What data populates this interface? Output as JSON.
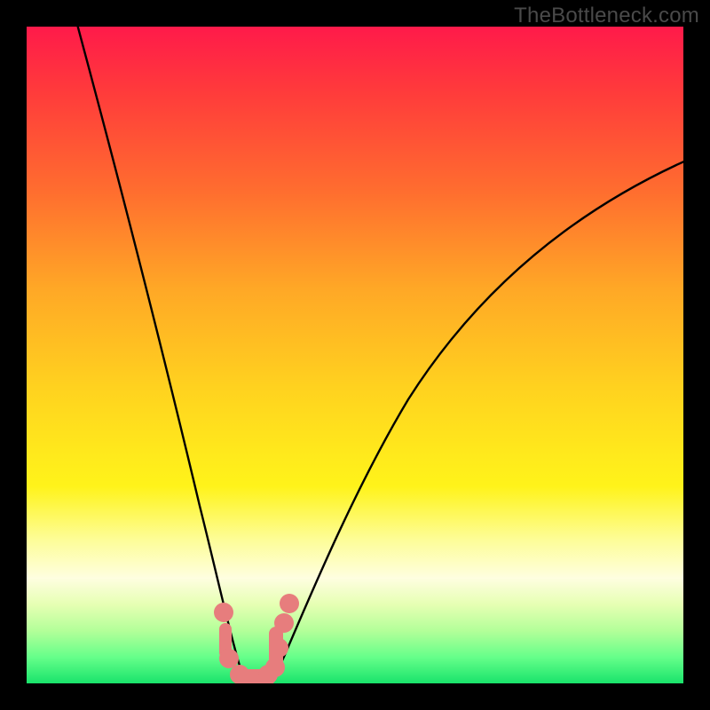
{
  "watermark": "TheBottleneck.com",
  "chart_data": {
    "type": "line",
    "title": "",
    "xlabel": "",
    "ylabel": "",
    "xlim": [
      0,
      100
    ],
    "ylim": [
      0,
      100
    ],
    "series": [
      {
        "name": "bottleneck-curve",
        "x": [
          5,
          8,
          12,
          16,
          20,
          24,
          26,
          28,
          30,
          31,
          32,
          33,
          34,
          35,
          37,
          39,
          41,
          45,
          50,
          56,
          62,
          70,
          80,
          92,
          100
        ],
        "y": [
          100,
          90,
          78,
          64,
          50,
          36,
          28,
          20,
          12,
          7,
          4,
          2,
          1,
          1,
          2,
          6,
          12,
          22,
          32,
          42,
          50,
          58,
          66,
          74,
          78
        ]
      }
    ],
    "highlight_points": {
      "name": "optimal-zone-markers",
      "x": [
        30.5,
        31,
        31.5,
        33,
        34.5,
        35.5,
        36,
        37,
        37.5,
        38
      ],
      "y": [
        10,
        6,
        3,
        1,
        1,
        1.5,
        2,
        5,
        8,
        12
      ]
    },
    "background_zones": [
      {
        "name": "severe-bottleneck",
        "color": "#ff1a4a",
        "y_range": [
          70,
          100
        ]
      },
      {
        "name": "high-bottleneck",
        "color": "#ff8a2a",
        "y_range": [
          40,
          70
        ]
      },
      {
        "name": "moderate-bottleneck",
        "color": "#ffe91c",
        "y_range": [
          15,
          40
        ]
      },
      {
        "name": "optimal-zone",
        "color": "#19e36b",
        "y_range": [
          0,
          15
        ]
      }
    ]
  }
}
